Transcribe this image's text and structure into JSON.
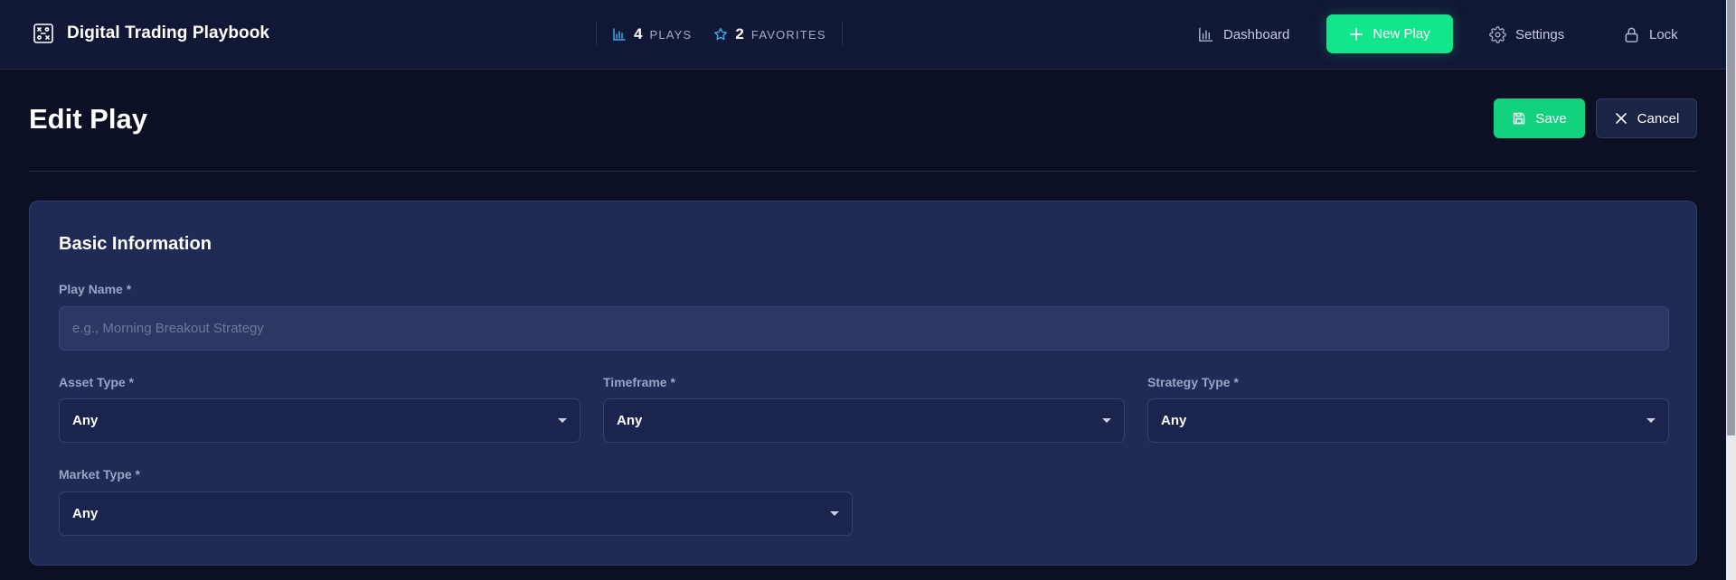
{
  "app": {
    "title": "Digital Trading Playbook"
  },
  "stats": {
    "plays": {
      "count": "4",
      "label": "PLAYS",
      "icon": "bar-chart-icon"
    },
    "favorites": {
      "count": "2",
      "label": "FAVORITES",
      "icon": "star-icon"
    }
  },
  "nav": {
    "dashboard": {
      "label": "Dashboard",
      "icon": "bar-chart-icon"
    },
    "new_play": {
      "label": "New Play",
      "icon": "plus-icon"
    },
    "settings": {
      "label": "Settings",
      "icon": "gear-icon"
    },
    "lock": {
      "label": "Lock",
      "icon": "lock-icon"
    }
  },
  "page": {
    "title": "Edit Play",
    "save_label": "Save",
    "cancel_label": "Cancel"
  },
  "form": {
    "section_title": "Basic Information",
    "play_name": {
      "label": "Play Name *",
      "value": "",
      "placeholder": "e.g., Morning Breakout Strategy"
    },
    "asset_type": {
      "label": "Asset Type *",
      "value": "Any"
    },
    "timeframe": {
      "label": "Timeframe *",
      "value": "Any"
    },
    "strategy_type": {
      "label": "Strategy Type *",
      "value": "Any"
    },
    "market_type": {
      "label": "Market Type *",
      "value": "Any"
    }
  },
  "colors": {
    "accent": "#13e68a",
    "background": "#0b1025",
    "topbar": "#111835",
    "card": "#1f2a55",
    "stat_icon": "#38a9f0"
  }
}
